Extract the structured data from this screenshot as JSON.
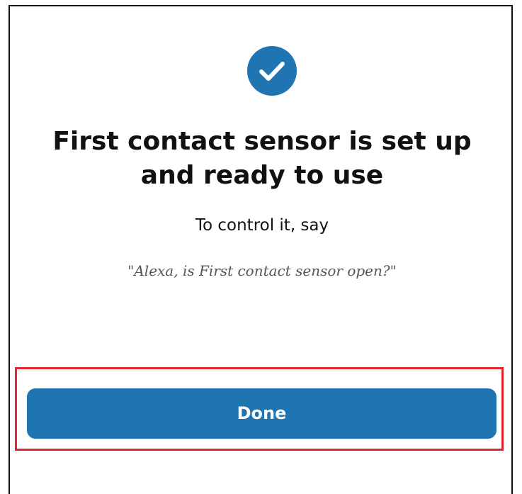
{
  "success_icon": {
    "name": "checkmark-icon",
    "color": "#1f74b2"
  },
  "setup_complete": {
    "title": "First contact sensor is set up and ready to use",
    "instruction": "To control it, say",
    "example_phrase": "\"Alexa, is First contact sensor open?\""
  },
  "actions": {
    "done_label": "Done",
    "button_color": "#1f74b2",
    "highlight_color": "#e2262e"
  }
}
